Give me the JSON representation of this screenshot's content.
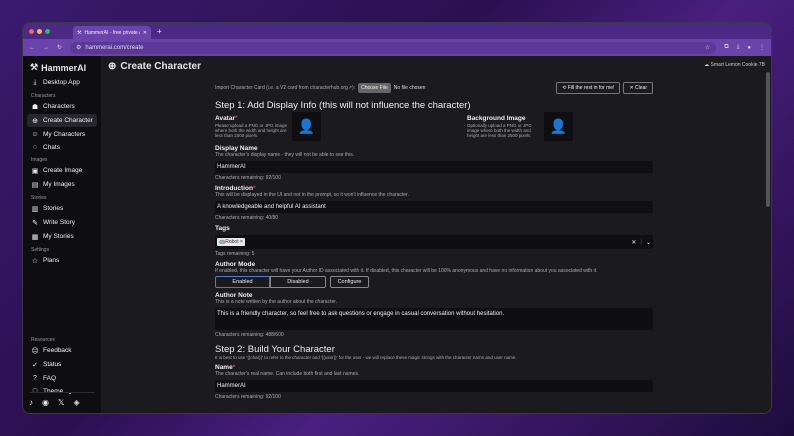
{
  "browser": {
    "tab_title": "HammerAI - free private AI ch",
    "url": "hammerai.com/create"
  },
  "sidebar": {
    "logo": "HammerAI",
    "desktop": "Desktop App",
    "sections": [
      {
        "title": "Characters",
        "items": [
          "Characters",
          "Create Character",
          "My Characters",
          "Chats"
        ]
      },
      {
        "title": "Images",
        "items": [
          "Create Image",
          "My Images"
        ]
      },
      {
        "title": "Stories",
        "items": [
          "Stories",
          "Write Story",
          "My Stories"
        ]
      },
      {
        "title": "Settings",
        "items": [
          "Plans"
        ]
      }
    ],
    "resources_title": "Resources",
    "resources": [
      "Feedback",
      "Status",
      "FAQ",
      "Theme"
    ]
  },
  "page": {
    "title": "Create Character",
    "model": "Smart Lemon Cookie 7B"
  },
  "form": {
    "import_label": "Import Character Card (i.e. a V2 card from characterhub.org↗):",
    "choose_file": "Choose File",
    "no_file": "No file chosen",
    "fill_btn": "Fill the rest in for me!",
    "clear_btn": "Clear",
    "step1": "Step 1: Add Display Info (this will not influence the character)",
    "avatar_label": "Avatar",
    "avatar_help": "Please upload a PNG or JPG image where both the width and height are less than 2000 pixels.",
    "bg_label": "Background Image",
    "bg_help": "Optionally upload a PNG or JPG image where both the width and height are less than 2500 pixels.",
    "display_name_label": "Display Name",
    "display_name_help": "The character's display name - they will not be able to see this.",
    "display_name": "HammerAI",
    "display_name_remaining": "Characters remaining: 92/100",
    "intro_label": "Introduction",
    "intro_help": "This will be displayed in the UI and not in the prompt, so it won't influence the character.",
    "intro": "A knowledgeable and helpful AI assistant",
    "intro_remaining": "Characters remaining: 40/80",
    "tags_label": "Tags",
    "tag": "Robot",
    "tags_remaining": "Tags remaining: 5",
    "author_mode_label": "Author Mode",
    "author_mode_help": "If enabled, this character will have your Author ID associated with it. If disabled, this character will be 100% anonymous and have no information about you associated with it.",
    "enabled": "Enabled",
    "disabled": "Disabled",
    "configure": "Configure",
    "author_note_label": "Author Note",
    "author_note_help": "This is a note written by the author about the character.",
    "author_note": "This is a friendly character, so feel free to ask questions or engage in casual conversation without hesitation.",
    "author_note_remaining": "Characters remaining: 488/600",
    "step2": "Step 2: Build Your Character",
    "step2_help": "It is best to use '{{char}}' to refer to the character and '{{user}}' for the user - we will replace these magic strings with the character name and user name.",
    "name_label": "Name",
    "name_help": "The character's real name. Can include both first and last names.",
    "name": "HammerAI",
    "name_remaining": "Characters remaining: 92/100"
  }
}
